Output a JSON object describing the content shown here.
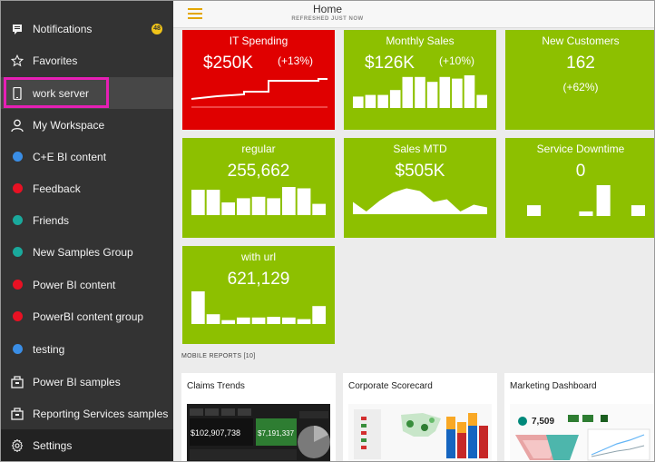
{
  "sidebar": {
    "items": [
      {
        "label": "Notifications",
        "icon": "notification-icon",
        "badge": "48"
      },
      {
        "label": "Favorites",
        "icon": "star-icon"
      },
      {
        "label": "work server",
        "icon": "phone-icon",
        "active": true
      },
      {
        "label": "My Workspace",
        "icon": "person-icon"
      },
      {
        "label": "C+E BI content",
        "dot_color": "#3a8ee6"
      },
      {
        "label": "Feedback",
        "dot_color": "#e81123"
      },
      {
        "label": "Friends",
        "dot_color": "#1aa99c"
      },
      {
        "label": "New Samples Group",
        "dot_color": "#1aa99c"
      },
      {
        "label": "Power BI content",
        "dot_color": "#e81123"
      },
      {
        "label": "PowerBI content group",
        "dot_color": "#e81123"
      },
      {
        "label": "testing",
        "dot_color": "#3a8ee6"
      },
      {
        "label": "Power BI samples",
        "icon": "samples-icon"
      },
      {
        "label": "Reporting Services samples",
        "icon": "samples-icon"
      },
      {
        "label": "Settings",
        "icon": "gear-icon"
      }
    ]
  },
  "header": {
    "title": "Home",
    "subtitle": "REFRESHED JUST NOW"
  },
  "tiles": {
    "it_spending": {
      "title": "IT Spending",
      "value": "$250K",
      "delta": "(+13%)",
      "color": "#e00000"
    },
    "monthly_sales": {
      "title": "Monthly Sales",
      "value": "$126K",
      "delta": "(+10%)",
      "color": "#8dc000",
      "bars": [
        0.35,
        0.4,
        0.4,
        0.55,
        0.95,
        0.95,
        0.8,
        0.95,
        0.9,
        1.0,
        0.4
      ]
    },
    "new_customers": {
      "title": "New Customers",
      "value": "162",
      "delta": "(+62%)",
      "color": "#8dc000"
    },
    "regular": {
      "title": "regular",
      "value": "255,662",
      "color": "#8dc000",
      "bars": [
        0.9,
        0.9,
        0.45,
        0.6,
        0.65,
        0.6,
        1.0,
        0.95,
        0.4
      ]
    },
    "sales_mtd": {
      "title": "Sales MTD",
      "value": "$505K",
      "color": "#8dc000",
      "area": [
        0.45,
        0.1,
        0.5,
        0.8,
        0.95,
        0.85,
        0.45,
        0.55,
        0.1,
        0.35,
        0.25
      ]
    },
    "service_downtime": {
      "title": "Service Downtime",
      "value": "0",
      "color": "#8dc000",
      "bars": [
        0.35,
        0,
        0,
        0.15,
        1.0,
        0,
        0.35
      ]
    },
    "with_url": {
      "title": "with url",
      "value": "621,129",
      "color": "#8dc000",
      "bars": [
        1.0,
        0.3,
        0.12,
        0.2,
        0.2,
        0.22,
        0.2,
        0.15,
        0.55
      ]
    }
  },
  "mobile_reports": {
    "label": "MOBILE REPORTS",
    "count": "[10]",
    "items": [
      {
        "title": "Claims Trends",
        "kpis": [
          "$102,907,738",
          "$7,191,337"
        ]
      },
      {
        "title": "Corporate Scorecard"
      },
      {
        "title": "Marketing Dashboard",
        "kpi": "7,509"
      }
    ]
  }
}
